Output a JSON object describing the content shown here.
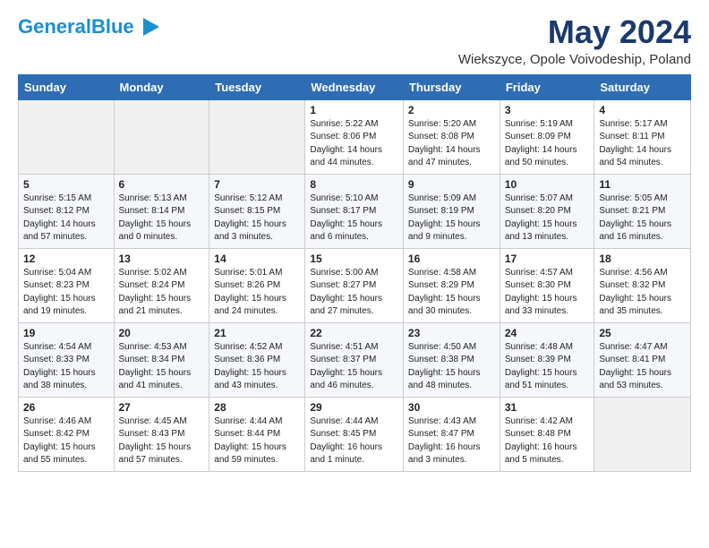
{
  "header": {
    "logo_line1": "General",
    "logo_line2": "Blue",
    "month_title": "May 2024",
    "location": "Wiekszyce, Opole Voivodeship, Poland"
  },
  "weekdays": [
    "Sunday",
    "Monday",
    "Tuesday",
    "Wednesday",
    "Thursday",
    "Friday",
    "Saturday"
  ],
  "weeks": [
    [
      {
        "day": "",
        "content": ""
      },
      {
        "day": "",
        "content": ""
      },
      {
        "day": "",
        "content": ""
      },
      {
        "day": "1",
        "content": "Sunrise: 5:22 AM\nSunset: 8:06 PM\nDaylight: 14 hours\nand 44 minutes."
      },
      {
        "day": "2",
        "content": "Sunrise: 5:20 AM\nSunset: 8:08 PM\nDaylight: 14 hours\nand 47 minutes."
      },
      {
        "day": "3",
        "content": "Sunrise: 5:19 AM\nSunset: 8:09 PM\nDaylight: 14 hours\nand 50 minutes."
      },
      {
        "day": "4",
        "content": "Sunrise: 5:17 AM\nSunset: 8:11 PM\nDaylight: 14 hours\nand 54 minutes."
      }
    ],
    [
      {
        "day": "5",
        "content": "Sunrise: 5:15 AM\nSunset: 8:12 PM\nDaylight: 14 hours\nand 57 minutes."
      },
      {
        "day": "6",
        "content": "Sunrise: 5:13 AM\nSunset: 8:14 PM\nDaylight: 15 hours\nand 0 minutes."
      },
      {
        "day": "7",
        "content": "Sunrise: 5:12 AM\nSunset: 8:15 PM\nDaylight: 15 hours\nand 3 minutes."
      },
      {
        "day": "8",
        "content": "Sunrise: 5:10 AM\nSunset: 8:17 PM\nDaylight: 15 hours\nand 6 minutes."
      },
      {
        "day": "9",
        "content": "Sunrise: 5:09 AM\nSunset: 8:19 PM\nDaylight: 15 hours\nand 9 minutes."
      },
      {
        "day": "10",
        "content": "Sunrise: 5:07 AM\nSunset: 8:20 PM\nDaylight: 15 hours\nand 13 minutes."
      },
      {
        "day": "11",
        "content": "Sunrise: 5:05 AM\nSunset: 8:21 PM\nDaylight: 15 hours\nand 16 minutes."
      }
    ],
    [
      {
        "day": "12",
        "content": "Sunrise: 5:04 AM\nSunset: 8:23 PM\nDaylight: 15 hours\nand 19 minutes."
      },
      {
        "day": "13",
        "content": "Sunrise: 5:02 AM\nSunset: 8:24 PM\nDaylight: 15 hours\nand 21 minutes."
      },
      {
        "day": "14",
        "content": "Sunrise: 5:01 AM\nSunset: 8:26 PM\nDaylight: 15 hours\nand 24 minutes."
      },
      {
        "day": "15",
        "content": "Sunrise: 5:00 AM\nSunset: 8:27 PM\nDaylight: 15 hours\nand 27 minutes."
      },
      {
        "day": "16",
        "content": "Sunrise: 4:58 AM\nSunset: 8:29 PM\nDaylight: 15 hours\nand 30 minutes."
      },
      {
        "day": "17",
        "content": "Sunrise: 4:57 AM\nSunset: 8:30 PM\nDaylight: 15 hours\nand 33 minutes."
      },
      {
        "day": "18",
        "content": "Sunrise: 4:56 AM\nSunset: 8:32 PM\nDaylight: 15 hours\nand 35 minutes."
      }
    ],
    [
      {
        "day": "19",
        "content": "Sunrise: 4:54 AM\nSunset: 8:33 PM\nDaylight: 15 hours\nand 38 minutes."
      },
      {
        "day": "20",
        "content": "Sunrise: 4:53 AM\nSunset: 8:34 PM\nDaylight: 15 hours\nand 41 minutes."
      },
      {
        "day": "21",
        "content": "Sunrise: 4:52 AM\nSunset: 8:36 PM\nDaylight: 15 hours\nand 43 minutes."
      },
      {
        "day": "22",
        "content": "Sunrise: 4:51 AM\nSunset: 8:37 PM\nDaylight: 15 hours\nand 46 minutes."
      },
      {
        "day": "23",
        "content": "Sunrise: 4:50 AM\nSunset: 8:38 PM\nDaylight: 15 hours\nand 48 minutes."
      },
      {
        "day": "24",
        "content": "Sunrise: 4:48 AM\nSunset: 8:39 PM\nDaylight: 15 hours\nand 51 minutes."
      },
      {
        "day": "25",
        "content": "Sunrise: 4:47 AM\nSunset: 8:41 PM\nDaylight: 15 hours\nand 53 minutes."
      }
    ],
    [
      {
        "day": "26",
        "content": "Sunrise: 4:46 AM\nSunset: 8:42 PM\nDaylight: 15 hours\nand 55 minutes."
      },
      {
        "day": "27",
        "content": "Sunrise: 4:45 AM\nSunset: 8:43 PM\nDaylight: 15 hours\nand 57 minutes."
      },
      {
        "day": "28",
        "content": "Sunrise: 4:44 AM\nSunset: 8:44 PM\nDaylight: 15 hours\nand 59 minutes."
      },
      {
        "day": "29",
        "content": "Sunrise: 4:44 AM\nSunset: 8:45 PM\nDaylight: 16 hours\nand 1 minute."
      },
      {
        "day": "30",
        "content": "Sunrise: 4:43 AM\nSunset: 8:47 PM\nDaylight: 16 hours\nand 3 minutes."
      },
      {
        "day": "31",
        "content": "Sunrise: 4:42 AM\nSunset: 8:48 PM\nDaylight: 16 hours\nand 5 minutes."
      },
      {
        "day": "",
        "content": ""
      }
    ]
  ]
}
